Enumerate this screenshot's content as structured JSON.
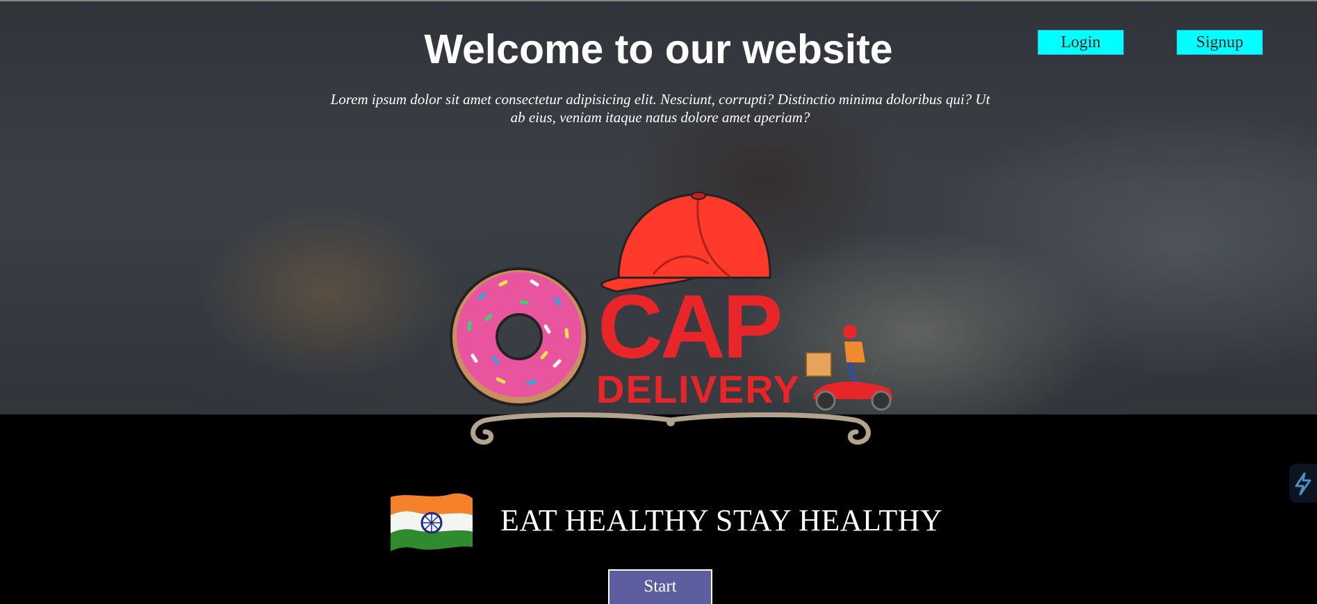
{
  "header": {
    "title": "Welcome to our website",
    "description": "Lorem ipsum dolor sit amet consectetur adipisicing elit. Nesciunt, corrupti? Distinctio minima doloribus qui? Ut ab eius, veniam itaque natus dolore amet aperiam?",
    "login_label": "Login",
    "signup_label": "Signup"
  },
  "logo": {
    "word_top": "CAP",
    "word_bottom": "DELIVERY",
    "icons": [
      "donut-icon",
      "red-cap-icon",
      "delivery-scooter-icon",
      "ornament-divider"
    ]
  },
  "main": {
    "slogan": "EAT HEALTHY STAY HEALTHY",
    "start_label": "Start",
    "flag_icon": "indian-flag-icon"
  },
  "colors": {
    "accent_button": "#00ffff",
    "start_button": "#5c5ea0",
    "logo_red": "#e8262a",
    "donut_pink": "#e8559e",
    "background": "#000000"
  }
}
